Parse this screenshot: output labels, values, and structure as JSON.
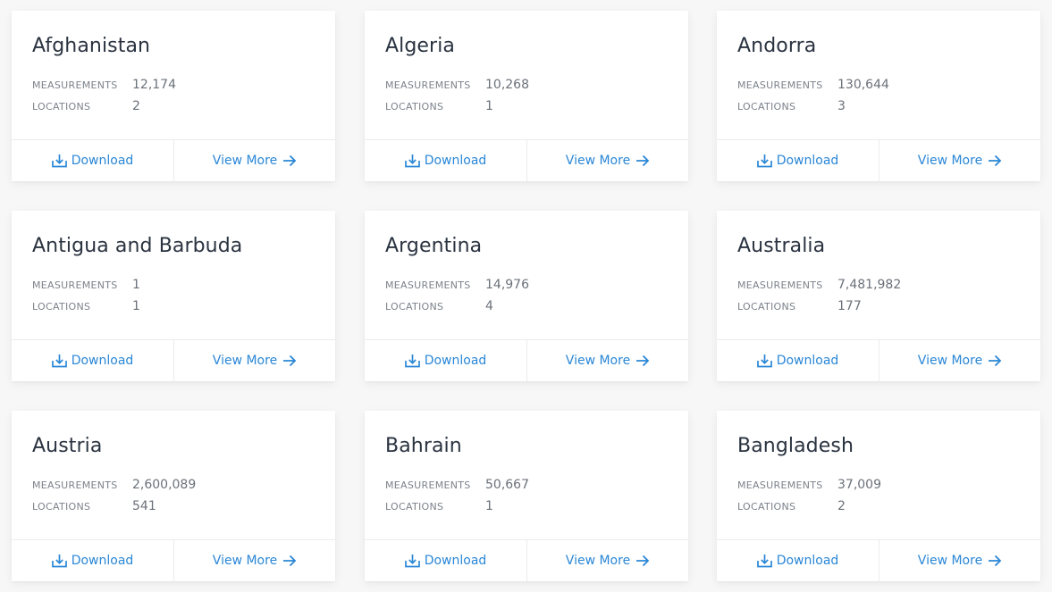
{
  "labels": {
    "measurements": "MEASUREMENTS",
    "locations": "LOCATIONS",
    "download": "Download",
    "view_more": "View More"
  },
  "colors": {
    "accent": "#2a87d6",
    "title": "#2a3340",
    "muted": "#7c828b"
  },
  "icons": {
    "download": "download-icon",
    "view_more": "arrow-right-icon"
  },
  "cards": [
    {
      "country": "Afghanistan",
      "measurements": "12,174",
      "locations": "2"
    },
    {
      "country": "Algeria",
      "measurements": "10,268",
      "locations": "1"
    },
    {
      "country": "Andorra",
      "measurements": "130,644",
      "locations": "3"
    },
    {
      "country": "Antigua and Barbuda",
      "measurements": "1",
      "locations": "1"
    },
    {
      "country": "Argentina",
      "measurements": "14,976",
      "locations": "4"
    },
    {
      "country": "Australia",
      "measurements": "7,481,982",
      "locations": "177"
    },
    {
      "country": "Austria",
      "measurements": "2,600,089",
      "locations": "541"
    },
    {
      "country": "Bahrain",
      "measurements": "50,667",
      "locations": "1"
    },
    {
      "country": "Bangladesh",
      "measurements": "37,009",
      "locations": "2"
    }
  ]
}
